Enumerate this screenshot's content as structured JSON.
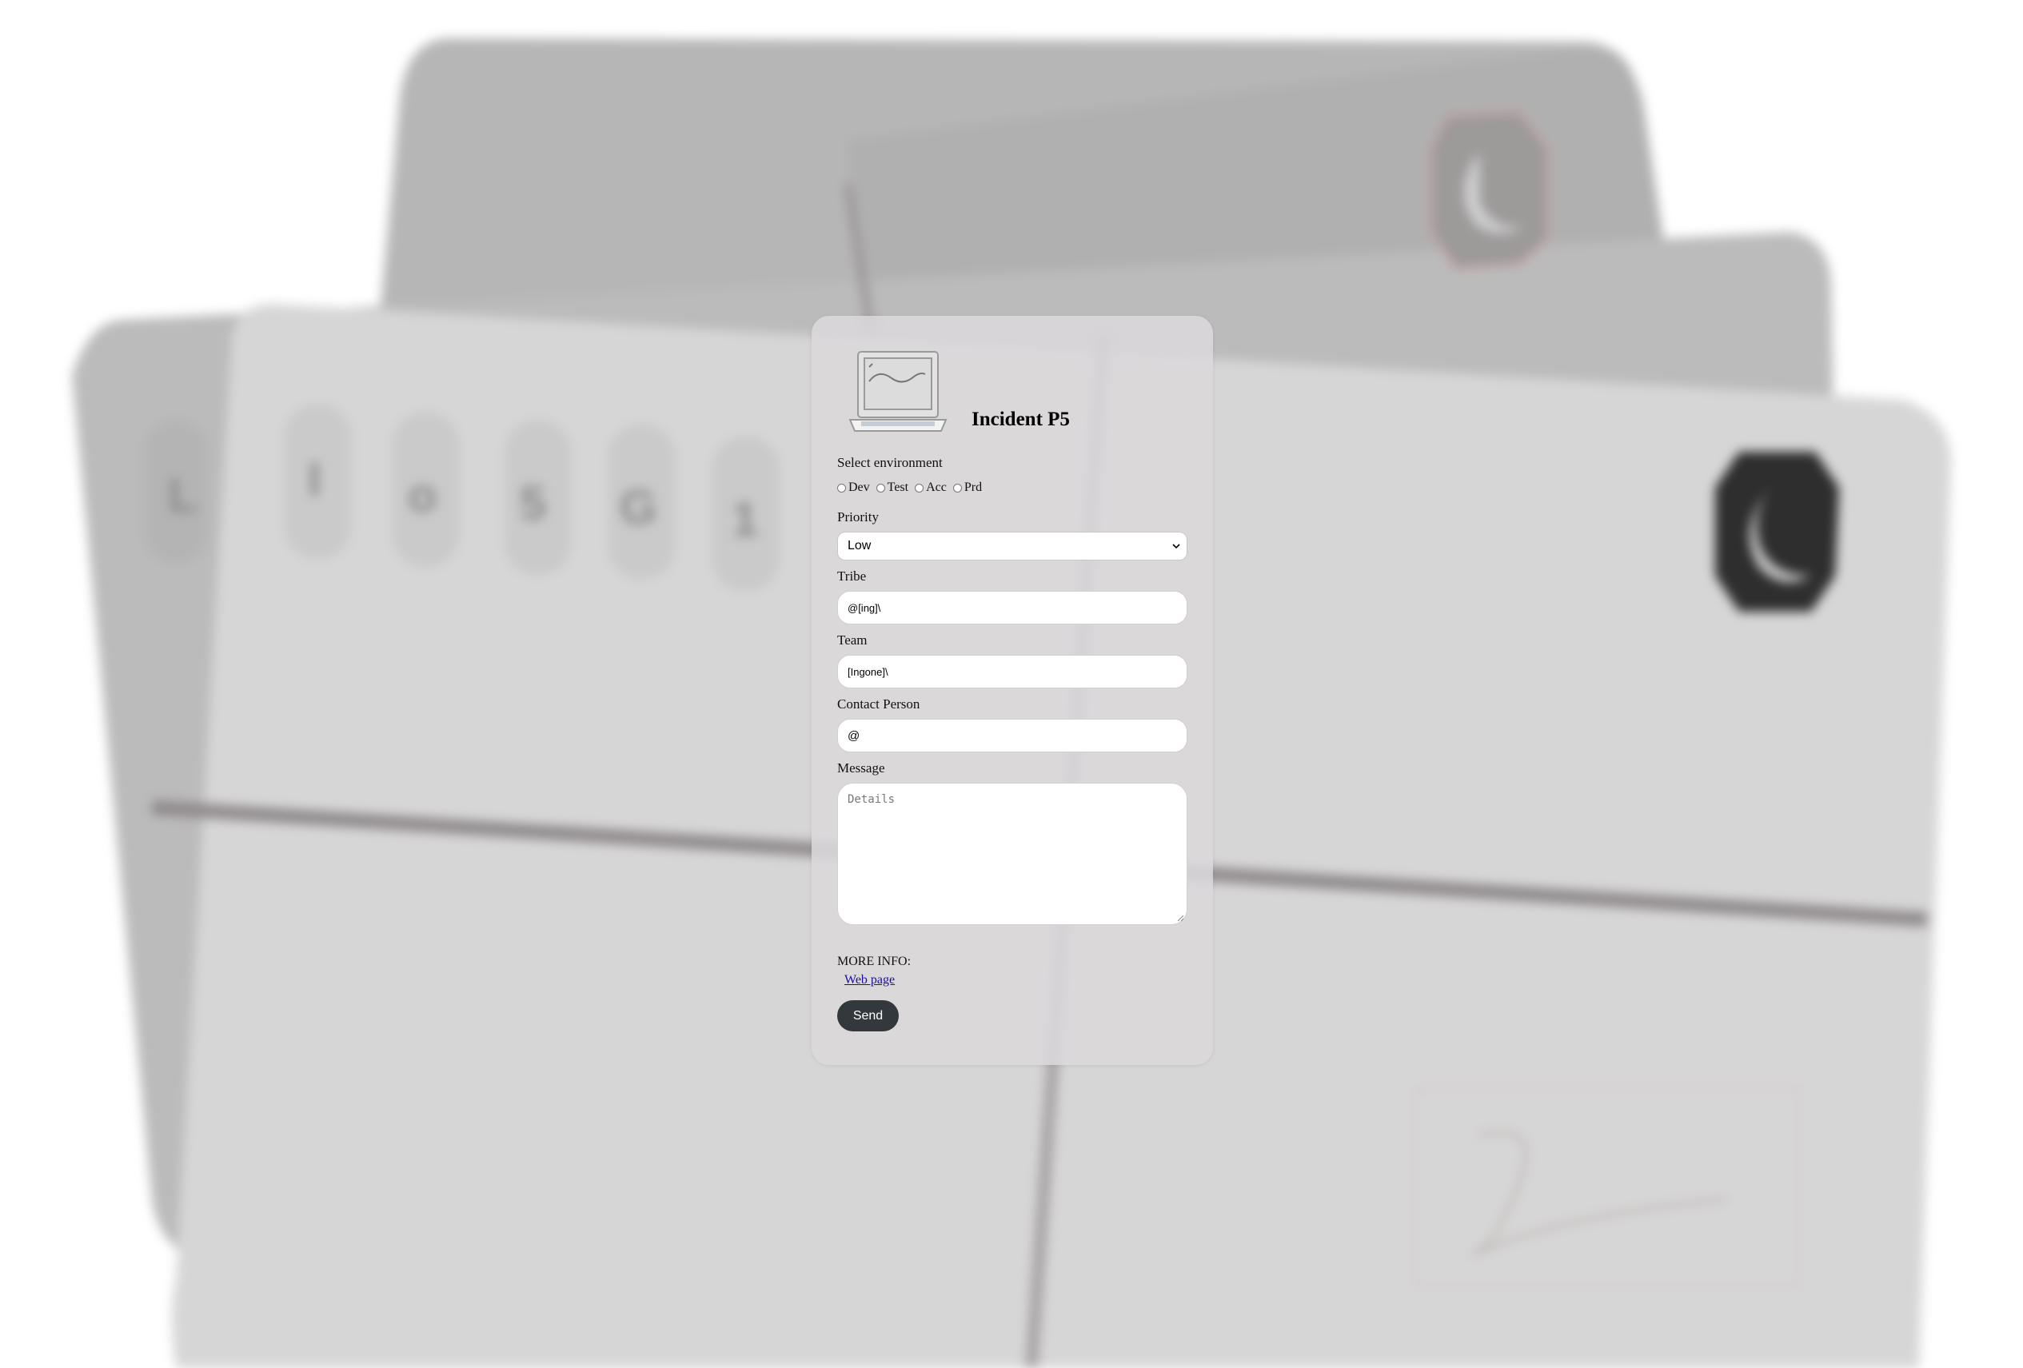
{
  "form": {
    "title": "Incident P5",
    "logo_icon": "laptop-icon",
    "environment": {
      "label": "Select environment",
      "options": [
        "Dev",
        "Test",
        "Acc",
        "Prd"
      ],
      "selected": null
    },
    "priority": {
      "label": "Priority",
      "value": "Low"
    },
    "tribe": {
      "label": "Tribe",
      "value": "@[ing]\\"
    },
    "team": {
      "label": "Team",
      "value": "[Ingone]\\"
    },
    "contact": {
      "label": "Contact Person",
      "value": "@"
    },
    "message": {
      "label": "Message",
      "placeholder": "Details",
      "value": ""
    },
    "more_info": {
      "label": "MORE INFO:",
      "link_text": "Web page"
    },
    "send_label": "Send"
  },
  "background": {
    "description_icons": [
      "moon-badge-icon",
      "key-icon"
    ],
    "key_chars": [
      "L",
      "I",
      "o",
      "5",
      "G",
      "1"
    ]
  },
  "colors": {
    "card_bg": "#dbd8db",
    "button_bg": "#33383c",
    "link": "#1a0dab"
  }
}
